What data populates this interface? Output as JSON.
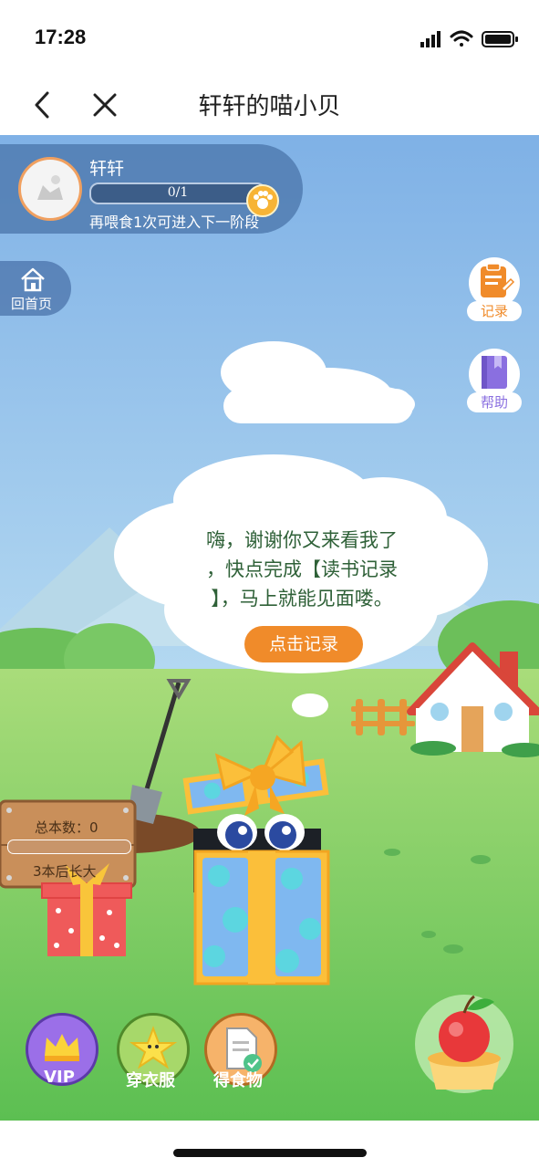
{
  "status_bar": {
    "time": "17:28"
  },
  "nav": {
    "title": "轩轩的喵小贝"
  },
  "profile": {
    "name": "轩轩",
    "progress_text": "0/1",
    "progress_fraction": 0,
    "stage_hint": "再喂食1次可进入下一阶段"
  },
  "home_button": {
    "label": "回首页"
  },
  "side_buttons": {
    "record": "记录",
    "help": "帮助"
  },
  "speech": {
    "line1": "嗨，谢谢你又来看我了",
    "line2": "，快点完成【读书记录",
    "line3": "】，马上就能见面喽。",
    "button": "点击记录"
  },
  "sign": {
    "total_label": "总本数：0",
    "grow_label": "3本后长大",
    "progress_fraction": 0
  },
  "bottom_buttons": {
    "vip": "VIP",
    "dress": "穿衣服",
    "food": "得食物"
  },
  "colors": {
    "accent_orange": "#f08b2a",
    "sky_top": "#7fb1e6",
    "grass": "#8fd46a",
    "speech_text": "#2f6138"
  }
}
